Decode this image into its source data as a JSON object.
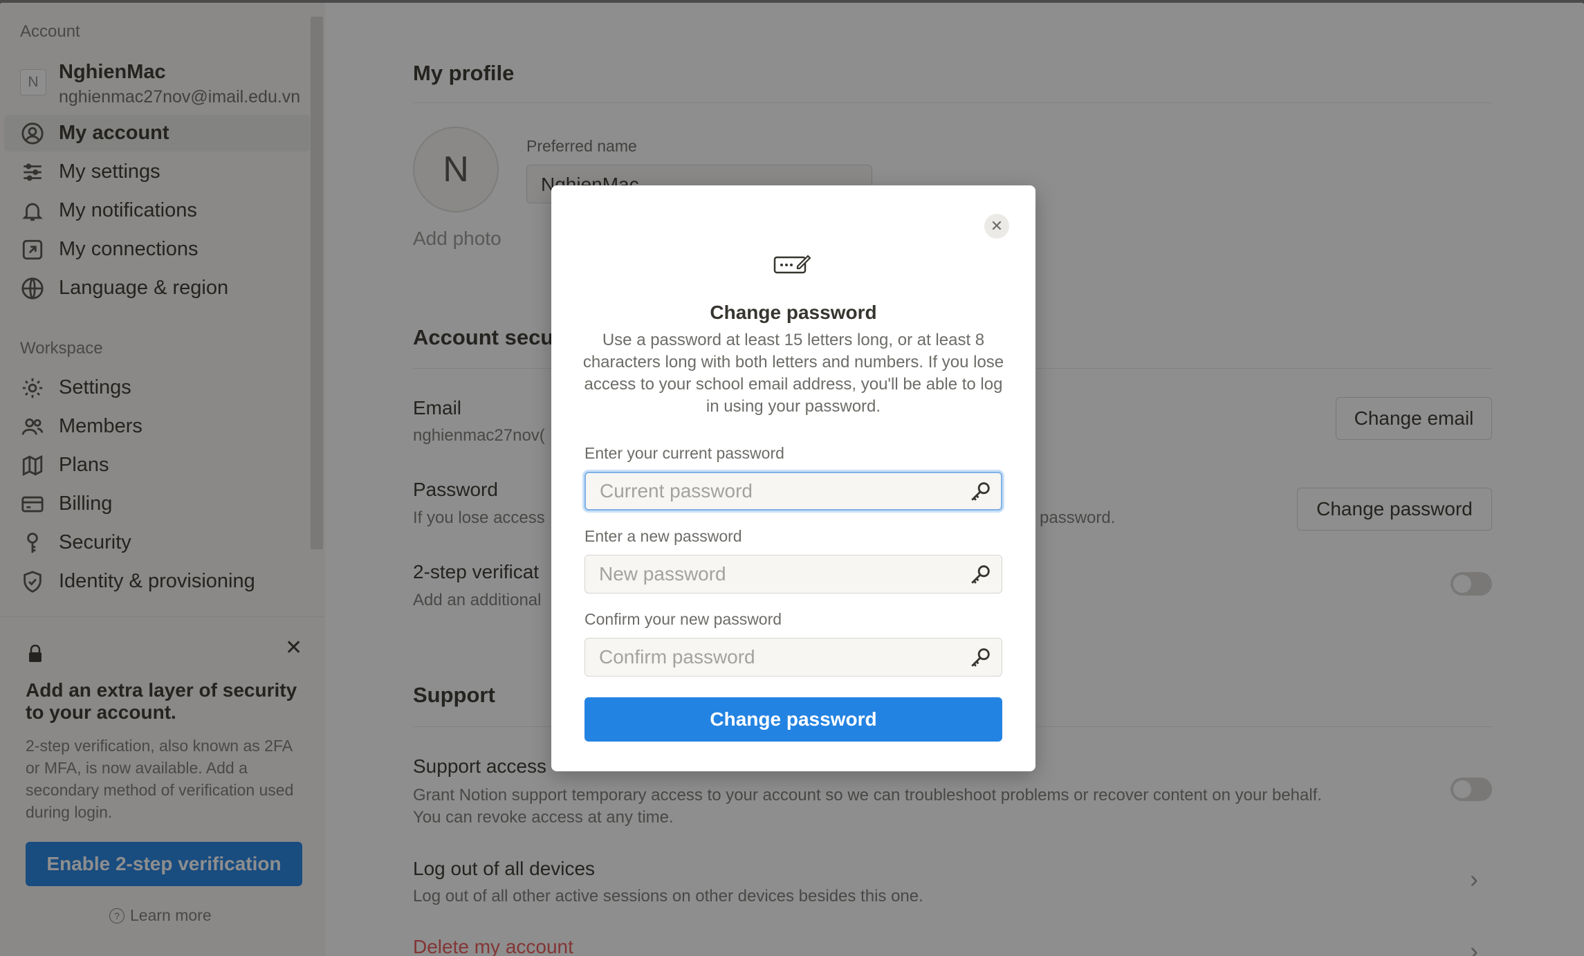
{
  "sidebar": {
    "account_label": "Account",
    "profile": {
      "initial": "N",
      "name": "NghienMac",
      "email": "nghienmac27nov@imail.edu.vn"
    },
    "account_items": [
      {
        "label": "My account",
        "icon": "user-circle-icon"
      },
      {
        "label": "My settings",
        "icon": "sliders-icon"
      },
      {
        "label": "My notifications",
        "icon": "bell-icon"
      },
      {
        "label": "My connections",
        "icon": "arrow-box-icon"
      },
      {
        "label": "Language & region",
        "icon": "globe-icon"
      }
    ],
    "workspace_label": "Workspace",
    "workspace_items": [
      {
        "label": "Settings",
        "icon": "gear-icon"
      },
      {
        "label": "Members",
        "icon": "people-icon"
      },
      {
        "label": "Plans",
        "icon": "map-icon"
      },
      {
        "label": "Billing",
        "icon": "card-icon"
      },
      {
        "label": "Security",
        "icon": "key-icon"
      },
      {
        "label": "Identity & provisioning",
        "icon": "shield-icon"
      }
    ],
    "promo": {
      "title": "Add an extra layer of security to your account.",
      "body": "2-step verification, also known as 2FA or MFA, is now available. Add a secondary method of verification used during login.",
      "button": "Enable 2-step verification",
      "learn_more": "Learn more"
    }
  },
  "main": {
    "profile_title": "My profile",
    "avatar_initial": "N",
    "add_photo": "Add photo",
    "preferred_name_label": "Preferred name",
    "preferred_name_value": "NghienMac",
    "security_title": "Account secu",
    "email_title": "Email",
    "email_sub": "nghienmac27nov(",
    "change_email_button": "Change email",
    "password_title": "Password",
    "password_sub_left": "If you lose access",
    "password_sub_right": "ur password.",
    "change_password_button": "Change password",
    "twostep_title": "2-step verificat",
    "twostep_sub": "Add an additional",
    "support_title": "Support",
    "support_access_title": "Support access",
    "support_access_sub": "Grant Notion support temporary access to your account so we can troubleshoot problems or recover content on your behalf. You can revoke access at any time.",
    "logout_title": "Log out of all devices",
    "logout_sub": "Log out of all other active sessions on other devices besides this one.",
    "delete_account": "Delete my account"
  },
  "modal": {
    "title": "Change password",
    "description": "Use a password at least 15 letters long, or at least 8 characters long with both letters and numbers. If you lose access to your school email address, you'll be able to log in using your password.",
    "current_label": "Enter your current password",
    "current_placeholder": "Current password",
    "new_label": "Enter a new password",
    "new_placeholder": "New password",
    "confirm_label": "Confirm your new password",
    "confirm_placeholder": "Confirm password",
    "submit": "Change password"
  },
  "colors": {
    "accent": "#2383e2",
    "danger": "#eb5757",
    "text": "#37352f",
    "muted": "#7c7b78"
  }
}
